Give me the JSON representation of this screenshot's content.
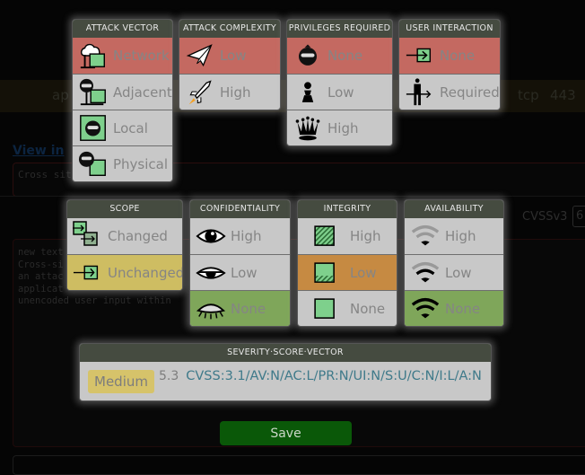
{
  "background": {
    "row_prefix": "ap",
    "protocol": "tcp",
    "port": "443",
    "link": "View in ",
    "title_input": "Cross sit",
    "cvss_label": "CVSSv3",
    "cvss_value": "6",
    "description_lines": [
      "new text",
      "Cross-si",
      "an attac",
      "applicat",
      "unencoded user input within"
    ]
  },
  "metrics": {
    "attack_vector": {
      "title": "ATTACK VECTOR",
      "options": [
        {
          "label": "Network",
          "icon": "cloud-network-icon",
          "state": "red"
        },
        {
          "label": "Adjacent",
          "icon": "hacker-network-icon",
          "state": ""
        },
        {
          "label": "Local",
          "icon": "hacker-local-icon",
          "state": ""
        },
        {
          "label": "Physical",
          "icon": "hacker-physical-icon",
          "state": ""
        }
      ]
    },
    "attack_complexity": {
      "title": "ATTACK COMPLEXITY",
      "options": [
        {
          "label": "Low",
          "icon": "paper-plane-icon",
          "state": "red"
        },
        {
          "label": "High",
          "icon": "rocket-icon",
          "state": ""
        }
      ]
    },
    "privileges_required": {
      "title": "PRIVILEGES REQUIRED",
      "options": [
        {
          "label": "None",
          "icon": "hacker-icon",
          "state": "red"
        },
        {
          "label": "Low",
          "icon": "pawn-icon",
          "state": ""
        },
        {
          "label": "High",
          "icon": "queen-icon",
          "state": ""
        }
      ]
    },
    "user_interaction": {
      "title": "USER INTERACTION",
      "options": [
        {
          "label": "None",
          "icon": "enter-box-icon",
          "state": "red"
        },
        {
          "label": "Required",
          "icon": "person-arrow-icon",
          "state": ""
        }
      ]
    },
    "scope": {
      "title": "SCOPE",
      "options": [
        {
          "label": "Changed",
          "icon": "scope-changed-icon",
          "state": ""
        },
        {
          "label": "Unchanged",
          "icon": "scope-unchanged-icon",
          "state": "yellow"
        }
      ]
    },
    "confidentiality": {
      "title": "CONFIDENTIALITY",
      "options": [
        {
          "label": "High",
          "icon": "eye-open-icon",
          "state": ""
        },
        {
          "label": "Low",
          "icon": "eye-half-icon",
          "state": ""
        },
        {
          "label": "None",
          "icon": "eye-closed-icon",
          "state": "green"
        }
      ]
    },
    "integrity": {
      "title": "INTEGRITY",
      "options": [
        {
          "label": "High",
          "icon": "square-hatched-full-icon",
          "state": ""
        },
        {
          "label": "Low",
          "icon": "square-hatched-low-icon",
          "state": "orange"
        },
        {
          "label": "None",
          "icon": "square-plain-icon",
          "state": "green-none"
        }
      ]
    },
    "availability": {
      "title": "AVAILABILITY",
      "options": [
        {
          "label": "High",
          "icon": "wifi-weak-icon",
          "state": ""
        },
        {
          "label": "Low",
          "icon": "wifi-medium-icon",
          "state": ""
        },
        {
          "label": "None",
          "icon": "wifi-full-icon",
          "state": "green"
        }
      ]
    }
  },
  "severity": {
    "title": "SEVERITY·SCORE·VECTOR",
    "rating": "Medium",
    "score": "5.3",
    "vector": "CVSS:3.1/AV:N/AC:L/PR:N/UI:N/S:U/C:N/I:L/A:N"
  },
  "save_label": "Save",
  "colors": {
    "selected_red": "#c46961",
    "selected_yellow": "#cebd62",
    "selected_orange": "#c68a42",
    "selected_green": "#7fa65a",
    "panel_header": "#454b40",
    "save_button": "#0a5808",
    "vector_text": "#3f7a8a"
  }
}
